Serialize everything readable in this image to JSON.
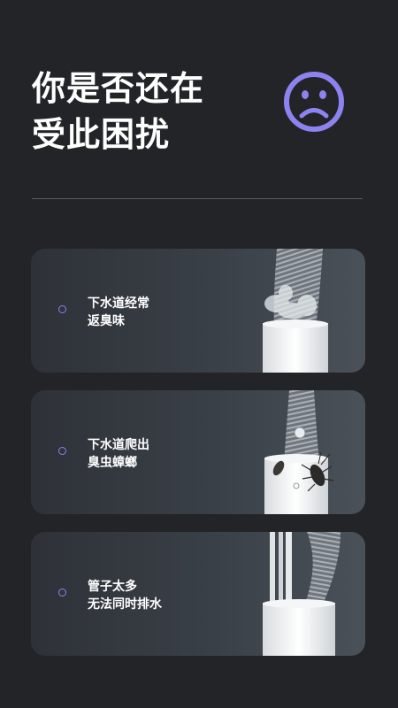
{
  "headline": {
    "line1": "你是否还在",
    "line2": "受此困扰"
  },
  "icons": {
    "mood": "sad-face-icon",
    "bullet": "circle-outline-icon"
  },
  "colors": {
    "accent": "#8c83ee",
    "background": "#222427"
  },
  "problems": [
    {
      "line1": "下水道经常",
      "line2": "返臭味",
      "illustration": "hose-with-odor"
    },
    {
      "line1": "下水道爬出",
      "line2": "臭虫蟑螂",
      "illustration": "hose-with-cockroach"
    },
    {
      "line1": "管子太多",
      "line2": "无法同时排水",
      "illustration": "multiple-pipes"
    }
  ]
}
